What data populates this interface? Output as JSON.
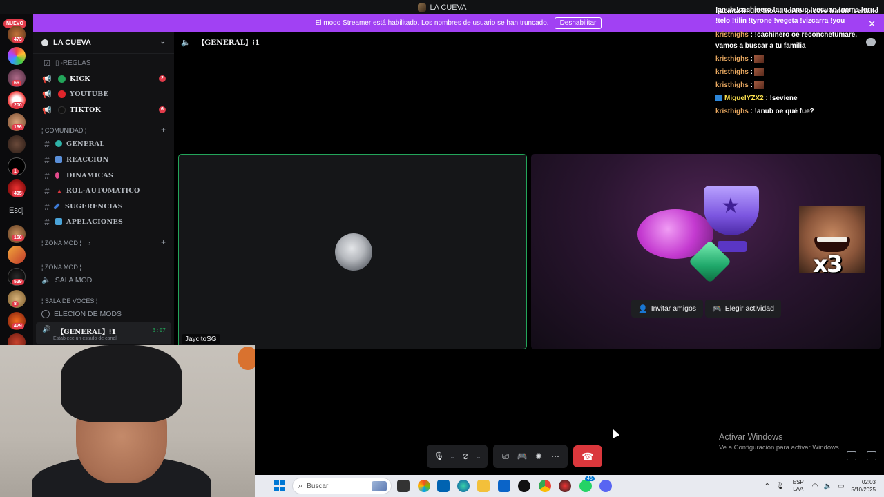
{
  "titlebar": {
    "title": "LA CUEVA"
  },
  "banner": {
    "text": "El modo Streamer está habilitado. Los nombres de usuario se han truncado.",
    "button": "Deshabilitar"
  },
  "rail": {
    "nuevo": "NUEVO",
    "badges": [
      "473",
      "66",
      "200",
      "166",
      "1",
      "495",
      "168",
      "529",
      "8",
      "429"
    ],
    "text_server": "Esdj"
  },
  "sidebar": {
    "server_name": "LA CUEVA",
    "rules": "-REGLAS",
    "announce": [
      {
        "name": "KICK",
        "color": "#23a55a",
        "badge": "2"
      },
      {
        "name": "YOUTUBE",
        "color": "#e0252b",
        "badge": ""
      },
      {
        "name": "TIKTOK",
        "color": "#111111",
        "badge": "6"
      }
    ],
    "cat_comunidad": "¦ COMUNIDAD ¦",
    "channels": [
      {
        "name": "GENERAL",
        "emoji_color": "#2fb3a8"
      },
      {
        "name": "REACCION",
        "emoji_color": "#5a8fd8"
      },
      {
        "name": "DINAMICAS",
        "emoji_color": "#e44a8c"
      },
      {
        "name": "ROL-AUTOMATICO",
        "emoji_color": "#d9363e"
      },
      {
        "name": "SUGERENCIAS",
        "emoji_color": "#3d7ad6"
      },
      {
        "name": "APELACIONES",
        "emoji_color": "#4aa3d8"
      }
    ],
    "cat_zona_mod_1": "¦ ZONA MOD ¦",
    "cat_zona_mod_2": "¦ ZONA MOD ¦",
    "sala_mod": "SALA MOD",
    "cat_sala_voces": "SALA DE VOCES ¦",
    "eleccion": "ELECION DE MODS",
    "active_channel": "【GENERAL】⁝1",
    "active_time": "3:07",
    "active_status": "Establece un estado de canal"
  },
  "voice": {
    "header": "【GENERAL】⁝1",
    "user_tile_name": "JaycitoSG"
  },
  "activity": {
    "invite": "Invitar amigos",
    "choose": "Elegir actividad",
    "meme_text": "x3"
  },
  "chat": {
    "lines": [
      {
        "user": "",
        "text": "!anub !cachinero !anu !anuo !vecuon !gema !gru !"
      },
      {
        "user": "",
        "text": "!jacinta !mura !novia !orco !picoro !raton !serrano"
      },
      {
        "user": "",
        "text": "!telo !tilin !tyrone !vegeta !vizcarra !you"
      },
      {
        "user": "kristhighs",
        "text": ": !cachinero oe reconchetumare,"
      },
      {
        "user": "",
        "text": "vamos a buscar a tu familia"
      },
      {
        "user": "kristhighs",
        "text": ":"
      },
      {
        "user": "kristhighs",
        "text": ":"
      },
      {
        "user": "kristhighs",
        "text": ":"
      },
      {
        "user": "MiguelYZX2",
        "text": ": !seviene"
      },
      {
        "user": "kristhighs",
        "text": ": !anub oe qué fue?"
      }
    ]
  },
  "windows_activation": {
    "title": "Activar Windows",
    "subtitle": "Ve a Configuración para activar Windows."
  },
  "taskbar": {
    "search_placeholder": "Buscar",
    "lang_top": "ESP",
    "lang_bottom": "LAA",
    "time": "02:03",
    "date": "5/10/2025",
    "whatsapp_badge": "46"
  }
}
